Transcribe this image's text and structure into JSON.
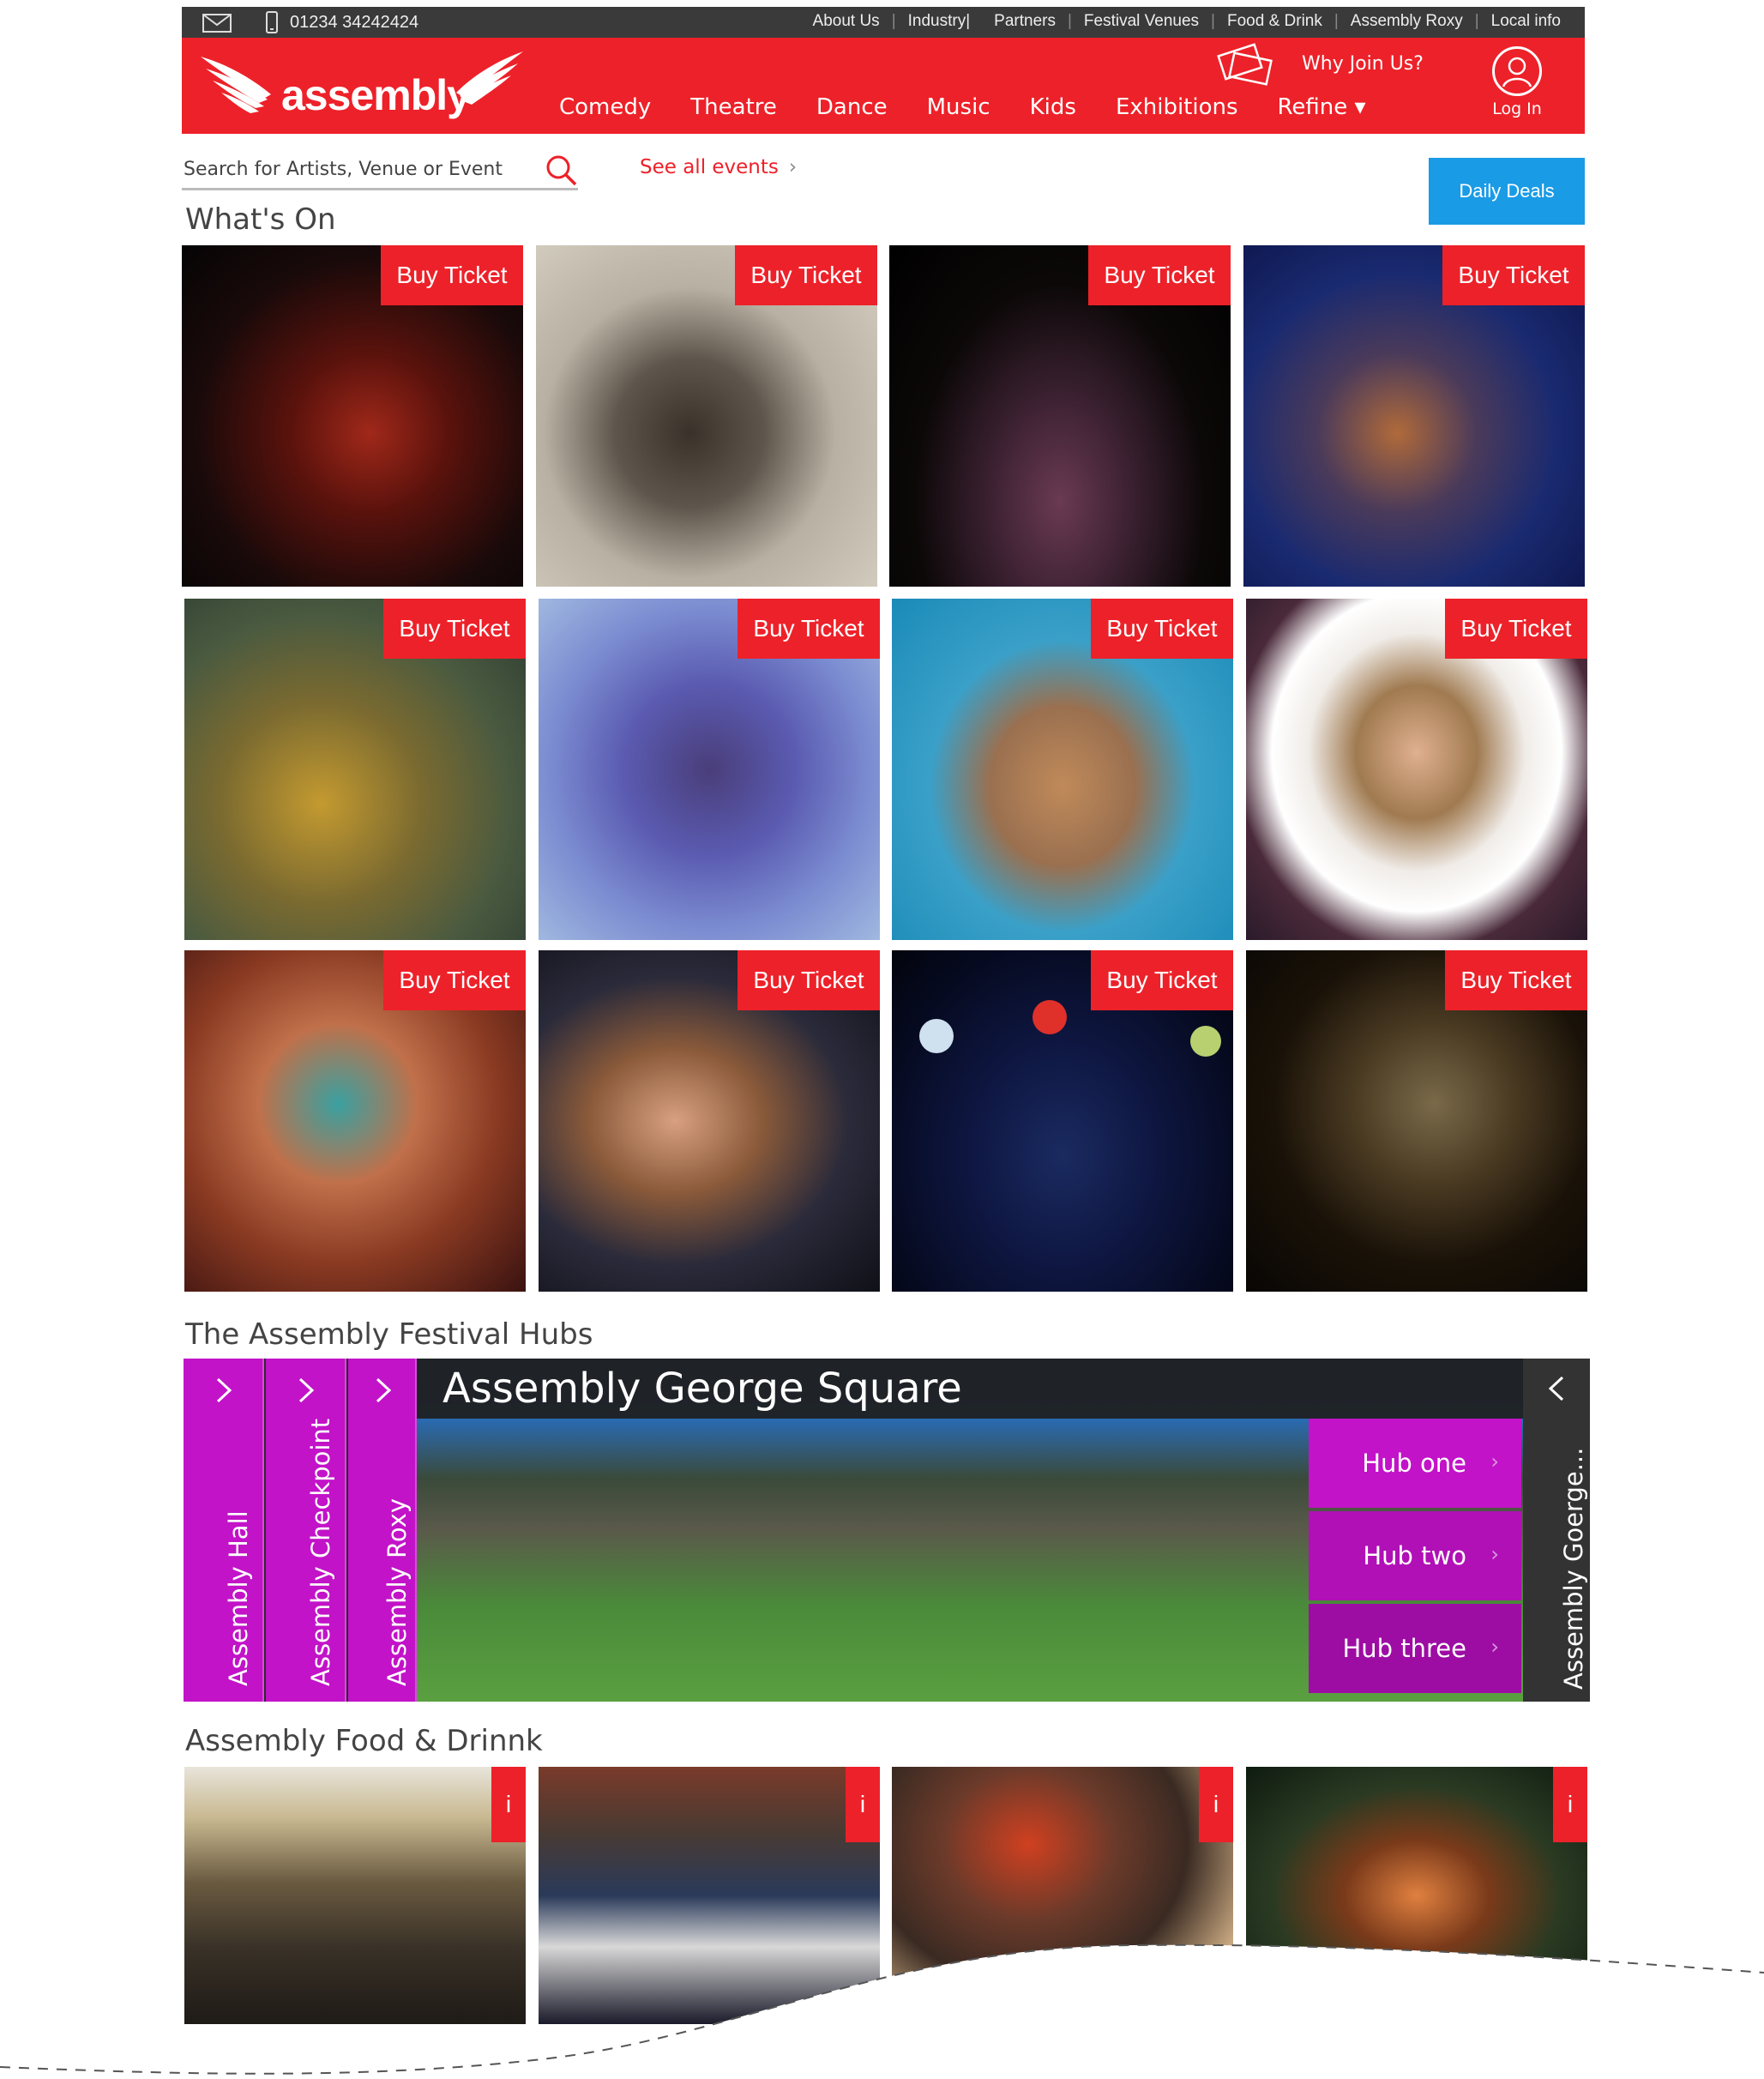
{
  "utility_bar": {
    "phone": "01234 34242424",
    "links": [
      "About Us",
      "Industry|",
      "Partners",
      "Festival Venues",
      "Food & Drink",
      "Assembly Roxy",
      "Local info"
    ]
  },
  "header": {
    "logo_text": "assembly",
    "why_join": "Why Join Us?",
    "login_label": "Log In",
    "nav": [
      "Comedy",
      "Theatre",
      "Dance",
      "Music",
      "Kids",
      "Exhibitions",
      "Refine ▾"
    ]
  },
  "search": {
    "placeholder": "Search for Artists, Venue or Event"
  },
  "see_all_events": "See all events",
  "daily_deals": "Daily Deals",
  "whats_on": {
    "title": "What's On",
    "buy_label": "Buy Ticket"
  },
  "hubs": {
    "title": "The Assembly Festival Hubs",
    "tabs": [
      "Assembly Hall",
      "Assembly Checkpoint",
      "Assembly Roxy"
    ],
    "active_title": "Assembly George Square",
    "buttons": [
      "Hub one",
      "Hub two",
      "Hub three"
    ],
    "side_label": "Assembly Goerge..."
  },
  "food": {
    "title": "Assembly Food & Drinnk",
    "badge": "i"
  },
  "colors": {
    "brand_red": "#ed2129",
    "hub_magenta": "#c213c8",
    "deals_blue": "#1a9be6",
    "utility_bar": "#3a3a3a"
  }
}
